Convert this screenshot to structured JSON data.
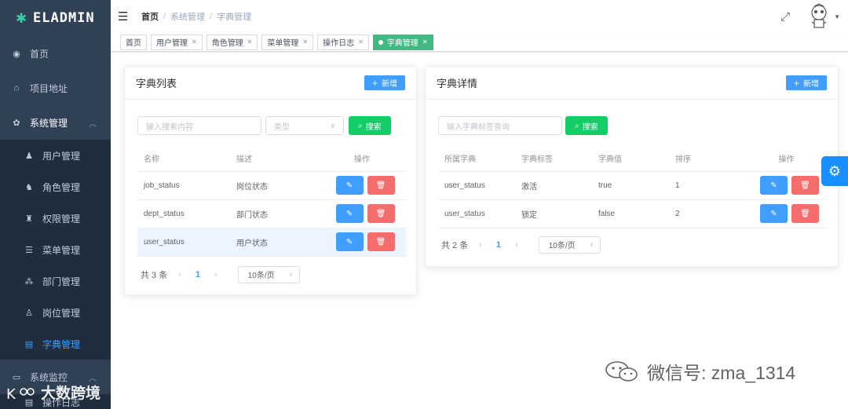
{
  "app": {
    "logo_text": "ELADMIN",
    "logo_mark": "✱"
  },
  "sidebar": {
    "items": [
      {
        "label": "首页",
        "icon": "dashboard-icon"
      },
      {
        "label": "项目地址",
        "icon": "github-icon"
      },
      {
        "label": "系统管理",
        "icon": "gear-icon"
      }
    ],
    "sub_items": [
      {
        "label": "用户管理",
        "icon": "user-icon"
      },
      {
        "label": "角色管理",
        "icon": "role-icon"
      },
      {
        "label": "权限管理",
        "icon": "permission-icon"
      },
      {
        "label": "菜单管理",
        "icon": "menu-icon"
      },
      {
        "label": "部门管理",
        "icon": "dept-icon"
      },
      {
        "label": "岗位管理",
        "icon": "job-icon"
      },
      {
        "label": "字典管理",
        "icon": "dictionary-icon"
      }
    ],
    "monitor_label": "系统监控",
    "log_label": "操作日志",
    "watermark": "大数跨境"
  },
  "navbar": {
    "breadcrumb": [
      "首页",
      "系统管理",
      "字典管理"
    ]
  },
  "tags": [
    {
      "label": "首页",
      "closable": false
    },
    {
      "label": "用户管理",
      "closable": true
    },
    {
      "label": "角色管理",
      "closable": true
    },
    {
      "label": "菜单管理",
      "closable": true
    },
    {
      "label": "操作日志",
      "closable": true
    },
    {
      "label": "字典管理",
      "closable": true,
      "active": true
    }
  ],
  "dict_list": {
    "title": "字典列表",
    "add_label": "新增",
    "search_placeholder": "输入搜索内容",
    "type_placeholder": "类型",
    "search_label": "搜索",
    "columns": [
      "名称",
      "描述",
      "操作"
    ],
    "rows": [
      {
        "name": "job_status",
        "desc": "岗位状态"
      },
      {
        "name": "dept_status",
        "desc": "部门状态"
      },
      {
        "name": "user_status",
        "desc": "用户状态"
      }
    ],
    "total": "共 3 条",
    "page": "1",
    "page_size": "10条/页"
  },
  "dict_detail": {
    "title": "字典详情",
    "add_label": "新增",
    "search_placeholder": "输入字典标签查询",
    "search_label": "搜索",
    "columns": [
      "所属字典",
      "字典标签",
      "字典值",
      "排序",
      "操作"
    ],
    "rows": [
      {
        "dict": "user_status",
        "label": "激活",
        "value": "true",
        "sort": "1"
      },
      {
        "dict": "user_status",
        "label": "锁定",
        "value": "false",
        "sort": "2"
      }
    ],
    "total": "共 2 条",
    "page": "1",
    "page_size": "10条/页"
  },
  "watermark_wechat": "微信号: zma_1314",
  "colors": {
    "sidebar": "#304156",
    "primary": "#409eff",
    "success": "#13ce66",
    "danger": "#f56c6c",
    "tag_active": "#42b983"
  }
}
